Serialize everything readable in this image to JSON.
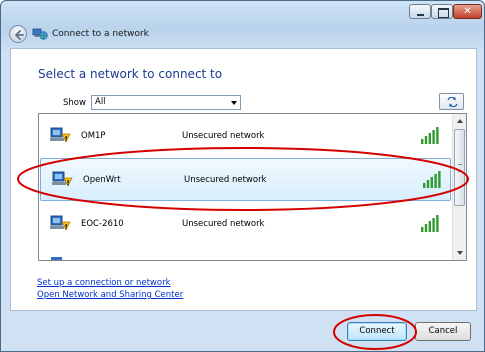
{
  "window": {
    "title": "Connect to a network",
    "controls": {
      "minimize_icon": "minimize-icon",
      "maximize_icon": "maximize-icon",
      "close_glyph": "✕"
    }
  },
  "heading": "Select a network to connect to",
  "filter": {
    "label": "Show",
    "value": "All"
  },
  "networks": [
    {
      "name": "OM1P",
      "security": "Unsecured network",
      "signal_bars": 5
    },
    {
      "name": "OpenWrt",
      "security": "Unsecured network",
      "signal_bars": 5,
      "selected": true
    },
    {
      "name": "EOC-2610",
      "security": "Unsecured network",
      "signal_bars": 5
    }
  ],
  "links": {
    "setup": "Set up a connection or network",
    "sharing_center": "Open Network and Sharing Center"
  },
  "buttons": {
    "connect": "Connect",
    "cancel": "Cancel"
  },
  "colors": {
    "heading": "#1c3b8f",
    "link": "#0033cc",
    "annotation": "#d40000",
    "signal": "#2f9a2f"
  }
}
